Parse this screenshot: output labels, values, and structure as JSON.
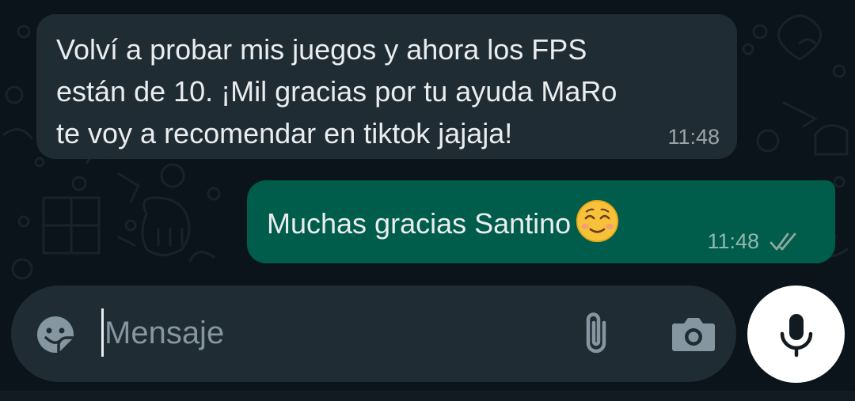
{
  "chat": {
    "messages": [
      {
        "direction": "incoming",
        "text": "Volví a probar mis juegos y ahora los FPS\nestán de 10. ¡Mil gracias por tu ayuda MaRo\nte voy a recomendar en tiktok jajaja!",
        "time": "11:48"
      },
      {
        "direction": "outgoing",
        "text": "Muchas gracias Santino",
        "emoji": "smiling-face-with-smiling-eyes",
        "time": "11:48",
        "status": "read-double-tick"
      }
    ]
  },
  "composer": {
    "placeholder": "Mensaje",
    "icons": {
      "left": "sticker-icon",
      "attach": "paperclip-icon",
      "camera": "camera-icon",
      "send": "microphone-icon"
    }
  },
  "colors": {
    "background": "#0b141a",
    "incoming_bubble": "#202c33",
    "outgoing_bubble": "#005c4b",
    "composer": "#202c33",
    "text": "#e9edef",
    "meta": "#8696a0",
    "mic_button": "#ffffff"
  }
}
